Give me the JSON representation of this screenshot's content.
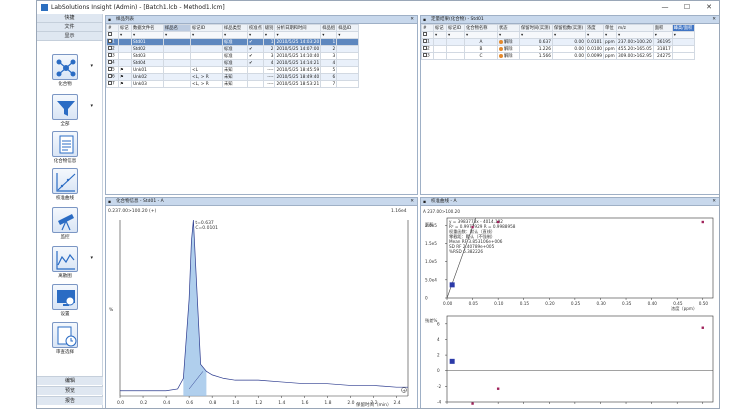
{
  "window": {
    "title": "LabSolutions Insight (Admin) - [Batch1.lcb - Method1.lcm]",
    "min": "—",
    "max": "☐",
    "close": "✕"
  },
  "sidebar": {
    "tabs": [
      "快捷",
      "文件",
      "显示"
    ],
    "tools": [
      {
        "label": "化合物",
        "icon": "compound-network-icon"
      },
      {
        "label": "全部",
        "icon": "filter-funnel-icon"
      },
      {
        "label": "化合物信息",
        "icon": "document-info-icon"
      },
      {
        "label": "校准曲线",
        "icon": "calibration-curve-icon"
      },
      {
        "label": "监控",
        "icon": "telescope-icon"
      },
      {
        "label": "离散图",
        "icon": "scatter-chart-icon"
      },
      {
        "label": "设置",
        "icon": "settings-monitor-icon"
      },
      {
        "label": "审查选择",
        "icon": "review-clock-icon"
      }
    ],
    "bottom": [
      "编辑",
      "预览",
      "报告"
    ]
  },
  "sample_panel": {
    "title": "样品列表",
    "headers": [
      "#",
      "标记",
      "数据文件名",
      "样品名",
      "标记ID",
      "样品类型",
      "校准点",
      "级别",
      "分析日期和时间",
      "样品组",
      "样品ID"
    ],
    "rows": [
      {
        "n": "1",
        "mark": "",
        "file": "Std01",
        "name": "",
        "tagid": "",
        "type": "标准",
        "cal": "✔",
        "level": "1",
        "date": "2010/5/25 14:03:20",
        "grp": "1",
        "sel": true
      },
      {
        "n": "2",
        "mark": "",
        "file": "Std02",
        "name": "",
        "tagid": "",
        "type": "标准",
        "cal": "✔",
        "level": "2",
        "date": "2010/5/25 14:07:00",
        "grp": "2",
        "sel": false
      },
      {
        "n": "3",
        "mark": "",
        "file": "Std03",
        "name": "",
        "tagid": "",
        "type": "标准",
        "cal": "✔",
        "level": "3",
        "date": "2010/5/25 14:10:40",
        "grp": "3",
        "sel": false
      },
      {
        "n": "4",
        "mark": "",
        "file": "Std04",
        "name": "",
        "tagid": "",
        "type": "标准",
        "cal": "✔",
        "level": "4",
        "date": "2010/5/25 14:14:21",
        "grp": "4",
        "sel": false
      },
      {
        "n": "5",
        "mark": "⚑",
        "file": "Unk01",
        "name": "",
        "tagid": "<L",
        "type": "未知",
        "cal": "",
        "level": "----",
        "date": "2010/5/25 18:45:59",
        "grp": "5",
        "sel": false
      },
      {
        "n": "6",
        "mark": "⚑",
        "file": "Unk02",
        "name": "",
        "tagid": "<L, > R",
        "type": "未知",
        "cal": "",
        "level": "----",
        "date": "2010/5/25 18:49:40",
        "grp": "6",
        "sel": false
      },
      {
        "n": "7",
        "mark": "⚑",
        "file": "Unk03",
        "name": "",
        "tagid": "<L, > R",
        "type": "未知",
        "cal": "",
        "level": "----",
        "date": "2010/5/25 18:53:21",
        "grp": "7",
        "sel": false
      }
    ]
  },
  "quant_panel": {
    "title": "定量结果(化合物) - Std01",
    "headers": [
      "#",
      "标记",
      "标记ID",
      "化合物名称",
      "状态",
      "保留时间(实测)",
      "保留指数(实测)",
      "浓度",
      "单位",
      "m/z",
      "面积",
      "峰高/面积"
    ],
    "rows": [
      {
        "n": "1",
        "name": "A",
        "status": "解除",
        "rt": "0.637",
        "ri": "0.00",
        "conc": "0.0101",
        "unit": "ppm",
        "mz": "237.00>100.20",
        "area": "36195"
      },
      {
        "n": "2",
        "name": "B",
        "status": "解除",
        "rt": "1.226",
        "ri": "0.00",
        "conc": "0.0100",
        "unit": "ppm",
        "mz": "455.20>165.05",
        "area": "31817"
      },
      {
        "n": "3",
        "name": "C",
        "status": "解除",
        "rt": "1.566",
        "ri": "0.00",
        "conc": "0.0099",
        "unit": "ppm",
        "mz": "309.00>162.95",
        "area": "24275"
      }
    ]
  },
  "chrom_panel": {
    "title": "化合物信息 - Std01 - A",
    "trace_label": "0.237.00>100.20 (+)",
    "y_label": "%",
    "y_max_label": "1.16e4",
    "peak_label_1": "t=0.637",
    "peak_label_2": "C=0.0101",
    "x_ticks": [
      "0.0",
      "0.2",
      "0.4",
      "0.6",
      "0.8",
      "1.0",
      "1.2",
      "1.4",
      "1.6",
      "1.8",
      "2.0",
      "2.2",
      "2.4"
    ],
    "x_unit": "保留时间（min）"
  },
  "calib_panel": {
    "title": "校准曲线 - A",
    "trace_label": "A 237.00>100.20",
    "eq_lines": [
      "y = 3983773x - 4014.102",
      "R² = 0.9977929  R = 0.9988958",
      "权重函数：默认（直线）",
      "零截距：默认（不强制）",
      "Mean RF 3.853106e+006",
      "SD RF 2.40789e+005",
      "%RSD 6.382226"
    ],
    "y_label": "面积",
    "y_ticks_top": [
      "2.0e5",
      "1.5e5",
      "1.0e5",
      "5.0e4",
      "0"
    ],
    "x_ticks": [
      "0.00",
      "0.05",
      "0.10",
      "0.15",
      "0.20",
      "0.25",
      "0.30",
      "0.35",
      "0.40",
      "0.45",
      "0.50"
    ],
    "x_unit": "浓度（ppm）",
    "residual_y_label": "残差%",
    "residual_y_ticks": [
      "6",
      "4",
      "2",
      "0",
      "-2",
      "-4"
    ]
  },
  "chart_data": [
    {
      "type": "line",
      "title": "化合物信息 - Std01 - A",
      "xlabel": "保留时间（min）",
      "ylabel": "%",
      "xlim": [
        0,
        2.5
      ],
      "ylim": [
        0,
        100
      ],
      "series": [
        {
          "x": [
            0.0,
            0.2,
            0.4,
            0.5,
            0.55,
            0.6,
            0.62,
            0.637,
            0.66,
            0.7,
            0.75,
            0.8,
            0.9,
            1.0,
            1.2,
            1.4,
            1.6,
            1.8,
            2.0,
            2.2,
            2.4,
            2.5
          ],
          "y": [
            3,
            3,
            3,
            4,
            10,
            55,
            88,
            100,
            70,
            18,
            14,
            12,
            10,
            9,
            9,
            8,
            7,
            7,
            6,
            6,
            5,
            5
          ]
        }
      ]
    },
    {
      "type": "scatter",
      "title": "校准曲线 - A",
      "xlabel": "浓度（ppm）",
      "ylabel": "面积",
      "xlim": [
        0,
        0.52
      ],
      "ylim": [
        0,
        220000
      ],
      "series": [
        {
          "name": "points",
          "x": [
            0.0101,
            0.05,
            0.1,
            0.5
          ],
          "y": [
            36195,
            195000,
            400000,
            2000000
          ]
        }
      ],
      "fit": {
        "slope": 3983773,
        "intercept": -4014.102
      }
    },
    {
      "type": "scatter",
      "title": "residuals",
      "ylabel": "残差%",
      "xlim": [
        0,
        0.52
      ],
      "ylim": [
        -4,
        7
      ],
      "series": [
        {
          "x": [
            0.0101,
            0.05,
            0.1,
            0.5
          ],
          "y": [
            1.2,
            -4.2,
            -2.3,
            5.5
          ]
        }
      ]
    }
  ]
}
